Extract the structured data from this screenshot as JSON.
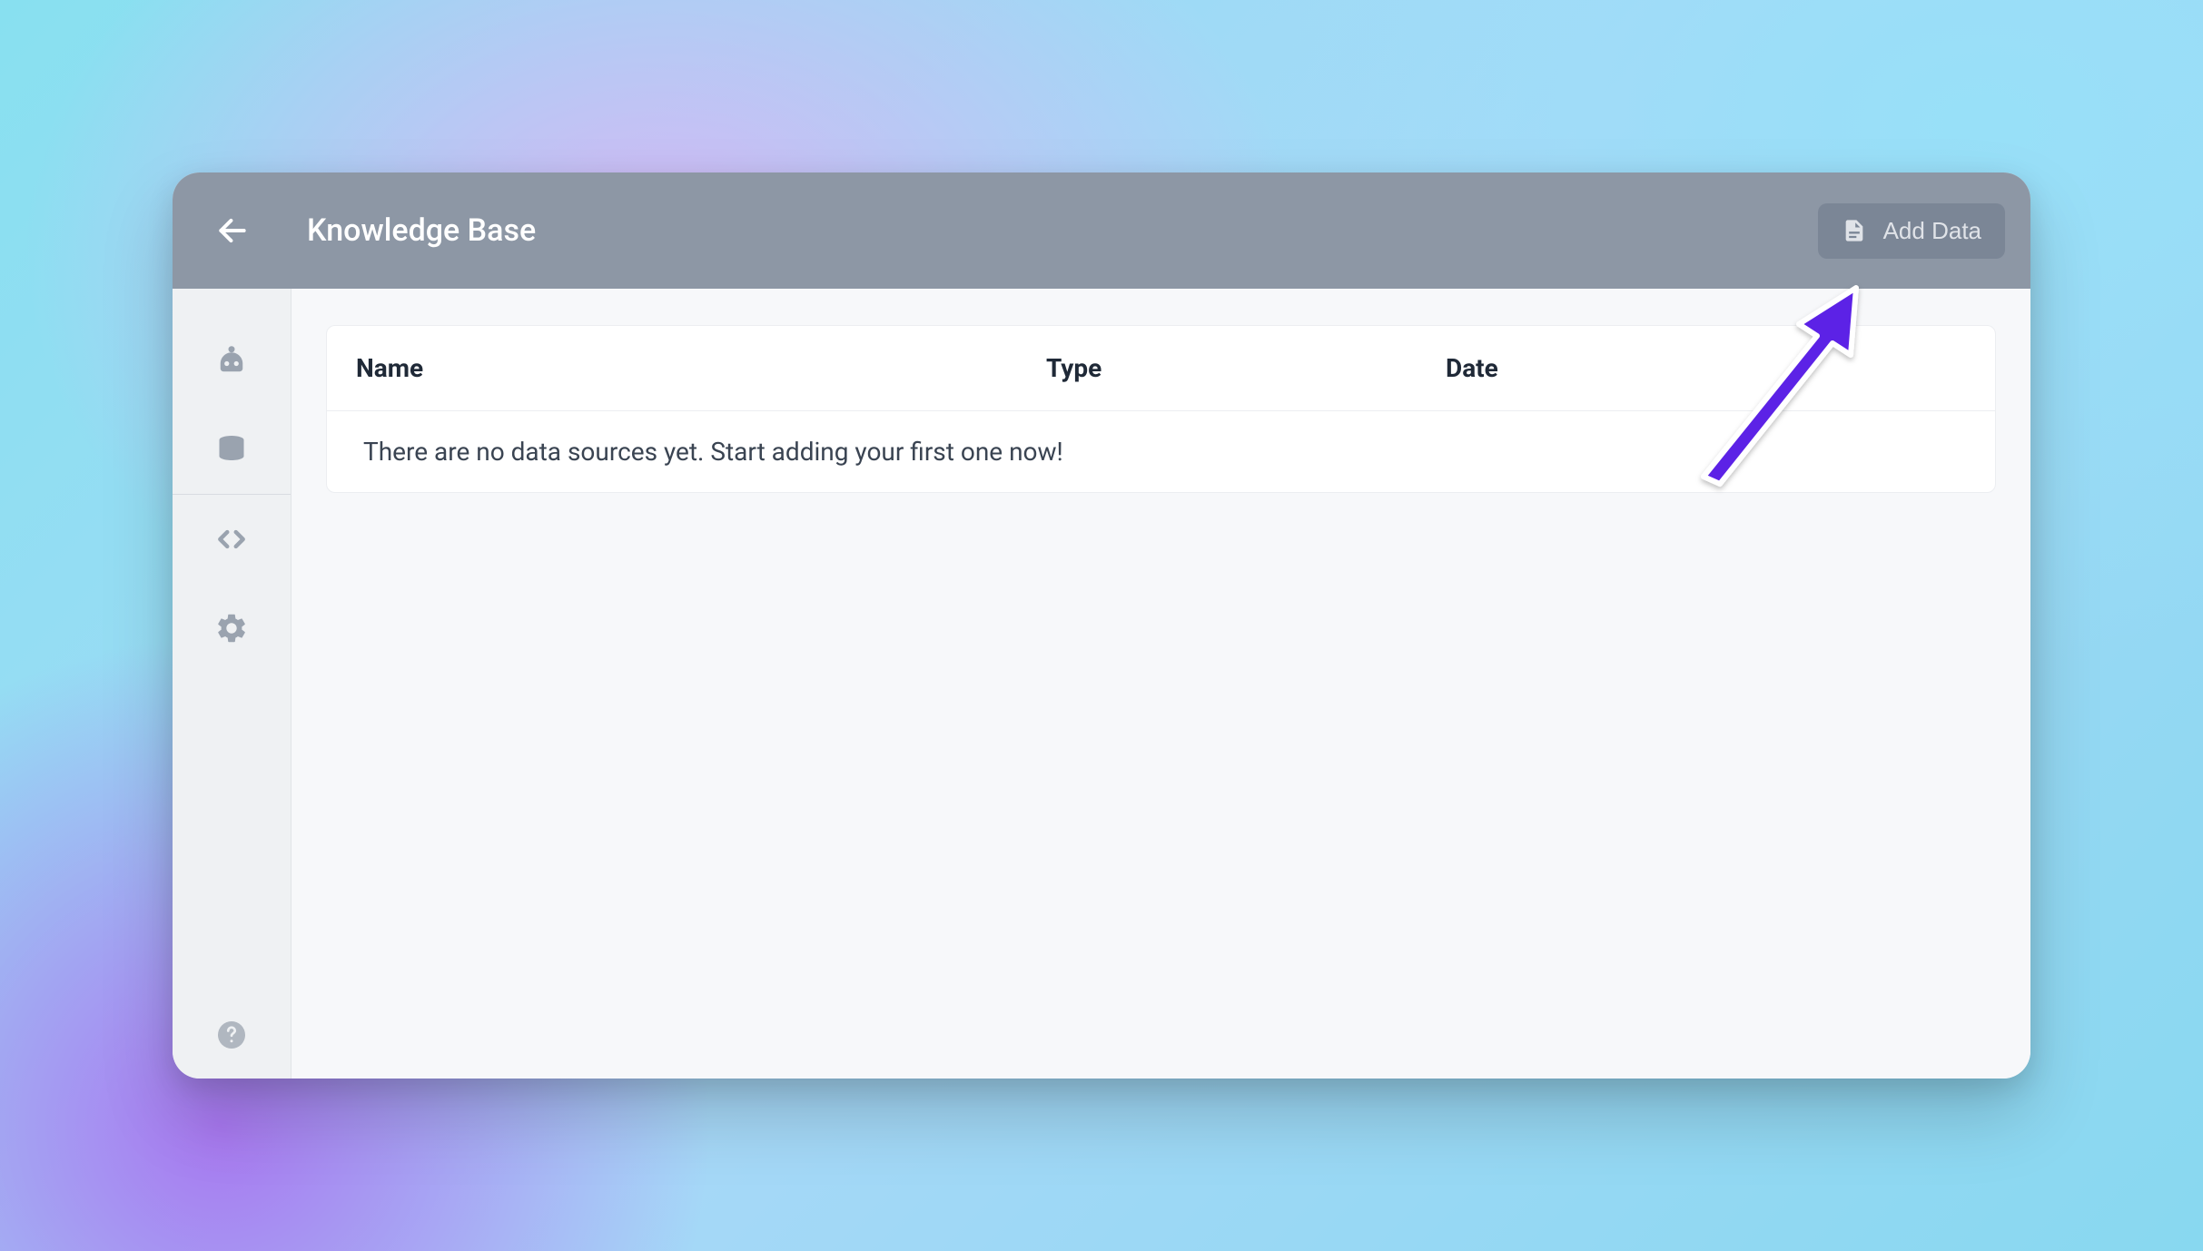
{
  "header": {
    "title": "Knowledge Base",
    "add_data_label": "Add Data"
  },
  "sidebar": {
    "items": [
      {
        "icon": "robot-icon"
      },
      {
        "icon": "database-icon"
      },
      {
        "icon": "code-icon"
      },
      {
        "icon": "gear-icon"
      }
    ]
  },
  "table": {
    "columns": {
      "name": "Name",
      "type": "Type",
      "date": "Date"
    },
    "empty_message": "There are no data sources yet. Start adding your first one now!"
  },
  "colors": {
    "header_bg": "#8d97a5",
    "button_bg": "#7b8696",
    "sidebar_bg": "#eff1f3",
    "arrow": "#5b21e6"
  }
}
